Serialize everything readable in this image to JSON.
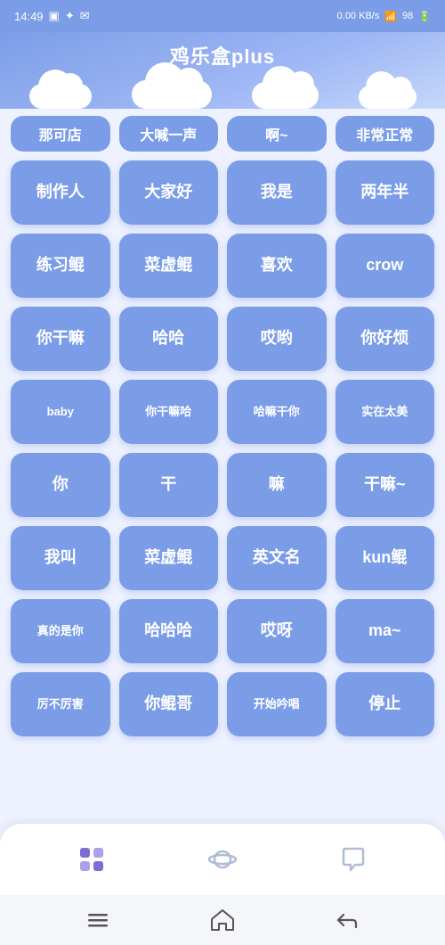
{
  "statusBar": {
    "time": "14:49",
    "network": "0.00 KB/s",
    "battery": "98"
  },
  "header": {
    "title": "鸡乐盒plus"
  },
  "partialRow": [
    "那可店",
    "大喊一声",
    "啊~",
    "非常正常"
  ],
  "buttons": [
    [
      "制作人",
      "大家好",
      "我是",
      "两年半"
    ],
    [
      "练习鲲",
      "菜虚鲲",
      "喜欢",
      "crow"
    ],
    [
      "你干嘛",
      "哈哈",
      "哎哟",
      "你好烦"
    ],
    [
      "baby",
      "你干嘛哈",
      "哈嘛干你",
      "实在太美"
    ],
    [
      "你",
      "干",
      "嘛",
      "干嘛~"
    ],
    [
      "我叫",
      "菜虚鲲",
      "英文名",
      "kun鲲"
    ],
    [
      "真的是你",
      "哈哈哈",
      "哎呀",
      "ma~"
    ],
    [
      "厉不厉害",
      "你鲲哥",
      "开始吟唱",
      "停止"
    ]
  ],
  "navItems": [
    {
      "icon": "grid",
      "active": true
    },
    {
      "icon": "planet",
      "active": false
    },
    {
      "icon": "chat",
      "active": false
    }
  ],
  "systemBar": {
    "menu": "☰",
    "home": "⌂",
    "back": "↩"
  }
}
